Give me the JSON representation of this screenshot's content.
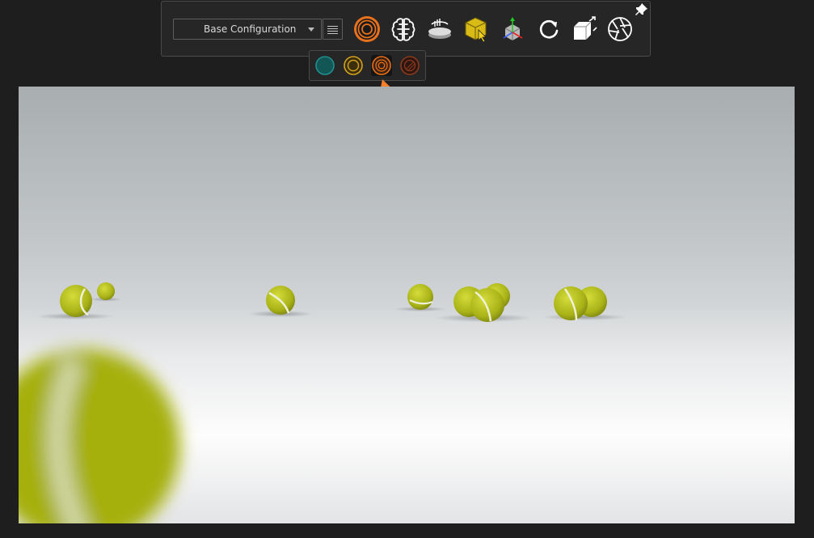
{
  "toolbar": {
    "config_value": "Base Configuration",
    "icons": [
      {
        "name": "render-mode-icon",
        "color": "#e8711c"
      },
      {
        "name": "brain-icon"
      },
      {
        "name": "turntable-icon"
      },
      {
        "name": "select-object-icon",
        "color": "#e8c41c"
      },
      {
        "name": "transform-gizmo-icon"
      },
      {
        "name": "refresh-icon"
      },
      {
        "name": "resize-output-icon"
      },
      {
        "name": "camera-shutter-icon"
      }
    ]
  },
  "render_modes": [
    {
      "name": "teal",
      "color": "#1f8f8f",
      "active": false
    },
    {
      "name": "yellow",
      "color": "#d4a21e",
      "active": false
    },
    {
      "name": "orange",
      "color": "#e8711c",
      "active": true
    },
    {
      "name": "dark-orange",
      "color": "#8a3a1e",
      "active": false
    }
  ],
  "colors": {
    "background": "#1e1e1e",
    "panel": "#262626",
    "accent_orange": "#e8711c",
    "annotation_arrow": "#f57f2a",
    "ball_yellow": "#b8c41a"
  }
}
